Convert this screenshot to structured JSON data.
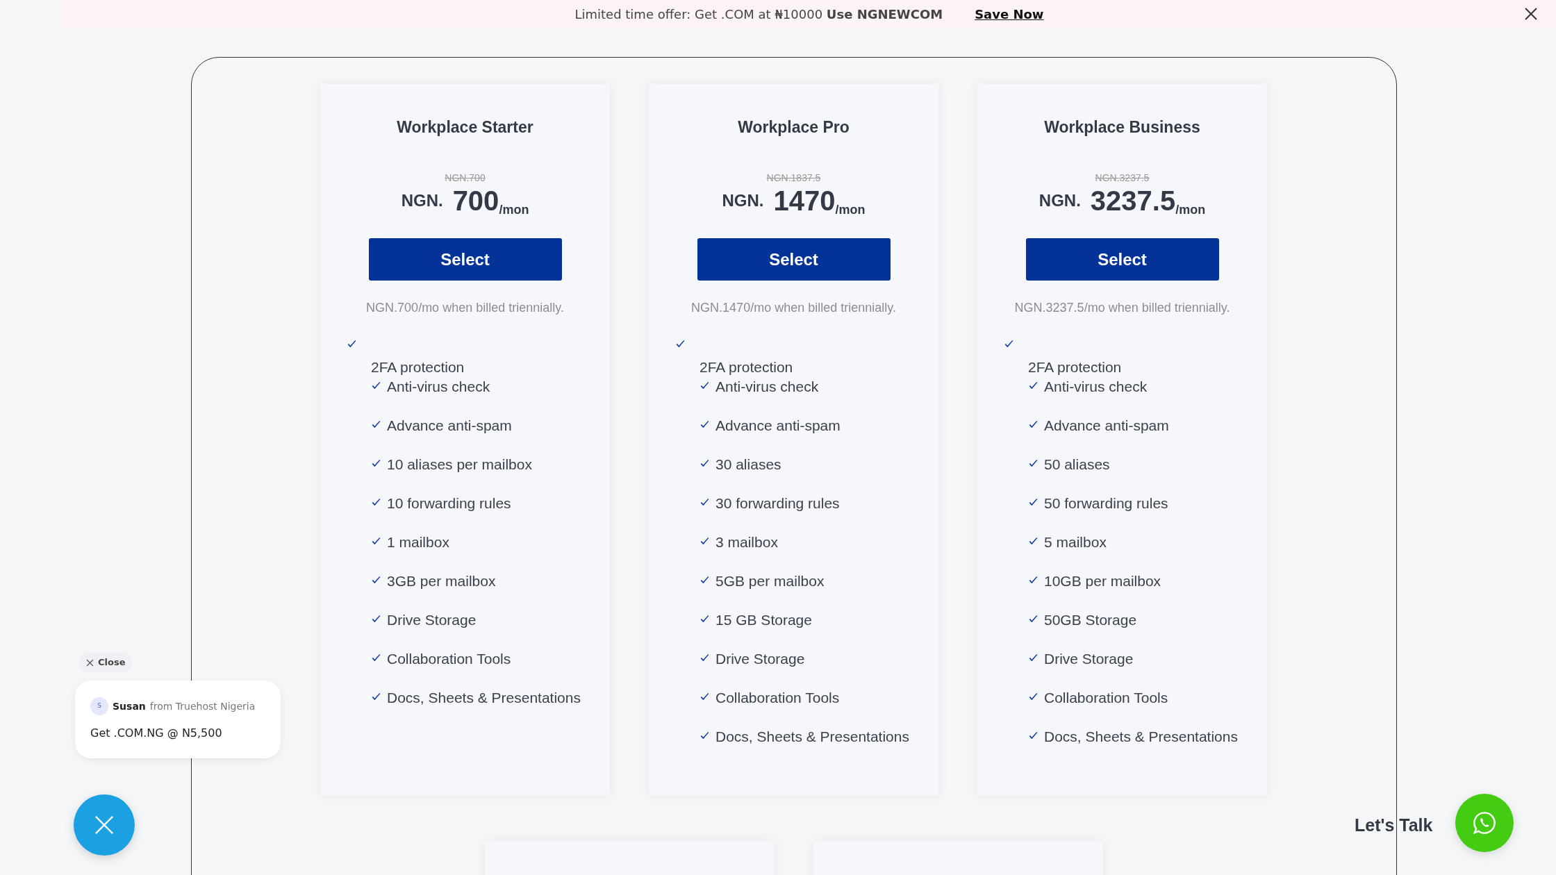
{
  "banner": {
    "message": "Limited time offer: Get .COM at ₦10000 **Use NGNEWCOM**",
    "link": "Save Now"
  },
  "plans": [
    {
      "name": "Workplace Starter",
      "old_price": "NGN.700",
      "currency": "NGN.",
      "price": "700",
      "period": "/mon",
      "button": "Select",
      "note": "NGN.700/mo when billed triennially.",
      "features": [
        {
          "kind": "split",
          "text": "2FA protection"
        },
        {
          "kind": "inline",
          "text": "Anti-virus check"
        },
        {
          "kind": "inline",
          "text": "Advance anti-spam"
        },
        {
          "kind": "inline",
          "text": "10 aliases per mailbox"
        },
        {
          "kind": "inline",
          "text": "10 forwarding rules"
        },
        {
          "kind": "inline",
          "text": "1 mailbox"
        },
        {
          "kind": "inline",
          "text": "3GB per mailbox"
        },
        {
          "kind": "inline",
          "text": "Drive Storage"
        },
        {
          "kind": "inline",
          "text": "Collaboration Tools"
        },
        {
          "kind": "inline",
          "text": "Docs, Sheets & Presentations"
        }
      ]
    },
    {
      "name": "Workplace Pro",
      "old_price": "NGN.1837.5",
      "currency": "NGN.",
      "price": "1470",
      "period": "/mon",
      "button": "Select",
      "note": "NGN.1470/mo when billed triennially.",
      "features": [
        {
          "kind": "split",
          "text": "2FA protection"
        },
        {
          "kind": "inline",
          "text": "Anti-virus check"
        },
        {
          "kind": "inline",
          "text": "Advance anti-spam"
        },
        {
          "kind": "inline",
          "text": "30 aliases"
        },
        {
          "kind": "inline",
          "text": "30 forwarding rules"
        },
        {
          "kind": "inline",
          "text": "3 mailbox"
        },
        {
          "kind": "inline",
          "text": "5GB per mailbox"
        },
        {
          "kind": "inline",
          "text": "15 GB Storage"
        },
        {
          "kind": "inline",
          "text": "Drive Storage"
        },
        {
          "kind": "inline",
          "text": "Collaboration Tools"
        },
        {
          "kind": "inline",
          "text": "Docs, Sheets & Presentations"
        }
      ]
    },
    {
      "name": "Workplace Business",
      "old_price": "NGN.3237.5",
      "currency": "NGN.",
      "price": "3237.5",
      "period": "/mon",
      "button": "Select",
      "note": "NGN.3237.5/mo when billed triennially.",
      "features": [
        {
          "kind": "split",
          "text": "2FA protection"
        },
        {
          "kind": "inline",
          "text": "Anti-virus check"
        },
        {
          "kind": "inline",
          "text": "Advance anti-spam"
        },
        {
          "kind": "inline",
          "text": "50 aliases"
        },
        {
          "kind": "inline",
          "text": "50 forwarding rules"
        },
        {
          "kind": "inline",
          "text": "5 mailbox"
        },
        {
          "kind": "inline",
          "text": "10GB per mailbox"
        },
        {
          "kind": "inline",
          "text": "50GB Storage"
        },
        {
          "kind": "inline",
          "text": "Drive Storage"
        },
        {
          "kind": "inline",
          "text": "Collaboration Tools"
        },
        {
          "kind": "inline",
          "text": "Docs, Sheets & Presentations"
        }
      ]
    }
  ],
  "chat_popup": {
    "close": "Close",
    "avatar": "S",
    "agent": "Susan",
    "company": "from Truehost Nigeria",
    "message": "Get .COM.NG @ N5,500"
  },
  "lets_talk": "Let's Talk"
}
